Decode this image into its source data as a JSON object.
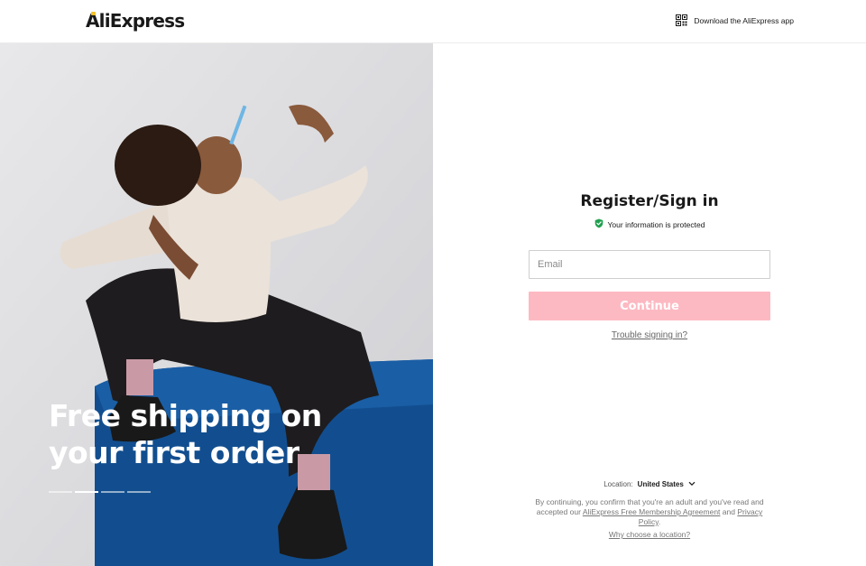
{
  "header": {
    "logo_text": "AliExpress",
    "download_label": "Download the AliExpress app",
    "download_icon": "qr-code-icon"
  },
  "hero": {
    "title": "Free shipping on your first order",
    "slides": 4,
    "active_slide": 2
  },
  "signin": {
    "title": "Register/Sign in",
    "protected_text": "Your information is protected",
    "email_placeholder": "Email",
    "email_value": "",
    "continue_label": "Continue",
    "trouble_label": "Trouble signing in?"
  },
  "footer": {
    "location_label": "Location:",
    "location_value": "United States",
    "terms_prefix": "By continuing, you confirm that you're an adult and you've read and accepted our",
    "terms_link1": "AliExpress Free Membership Agreement",
    "terms_and": "and",
    "terms_link2": "Privacy Policy",
    "terms_suffix": ".",
    "why_location": "Why choose a location?"
  },
  "colors": {
    "brand_yellow": "#f6c22a",
    "continue_disabled": "#fdb9c2",
    "shield_green": "#21a04f",
    "sofa_blue": "#124e8f"
  }
}
